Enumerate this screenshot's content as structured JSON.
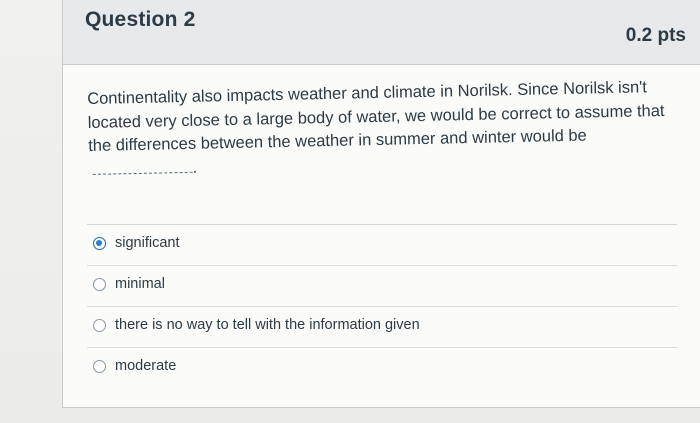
{
  "question": {
    "title": "Question 2",
    "points": "0.2 pts",
    "text": "Continentality also impacts weather and climate in Norilsk.  Since Norilsk isn't located very close to a large body of water, we would be correct to assume that the differences between the weather in summer and winter would be",
    "text_end": "."
  },
  "answers": [
    {
      "label": "significant",
      "selected": true
    },
    {
      "label": "minimal",
      "selected": false
    },
    {
      "label": "there is no way to tell with the information given",
      "selected": false
    },
    {
      "label": "moderate",
      "selected": false
    }
  ],
  "colors": {
    "header_bg": "#e7e9eb",
    "text": "#2d3b45",
    "radio_selected": "#2a7fcd"
  }
}
